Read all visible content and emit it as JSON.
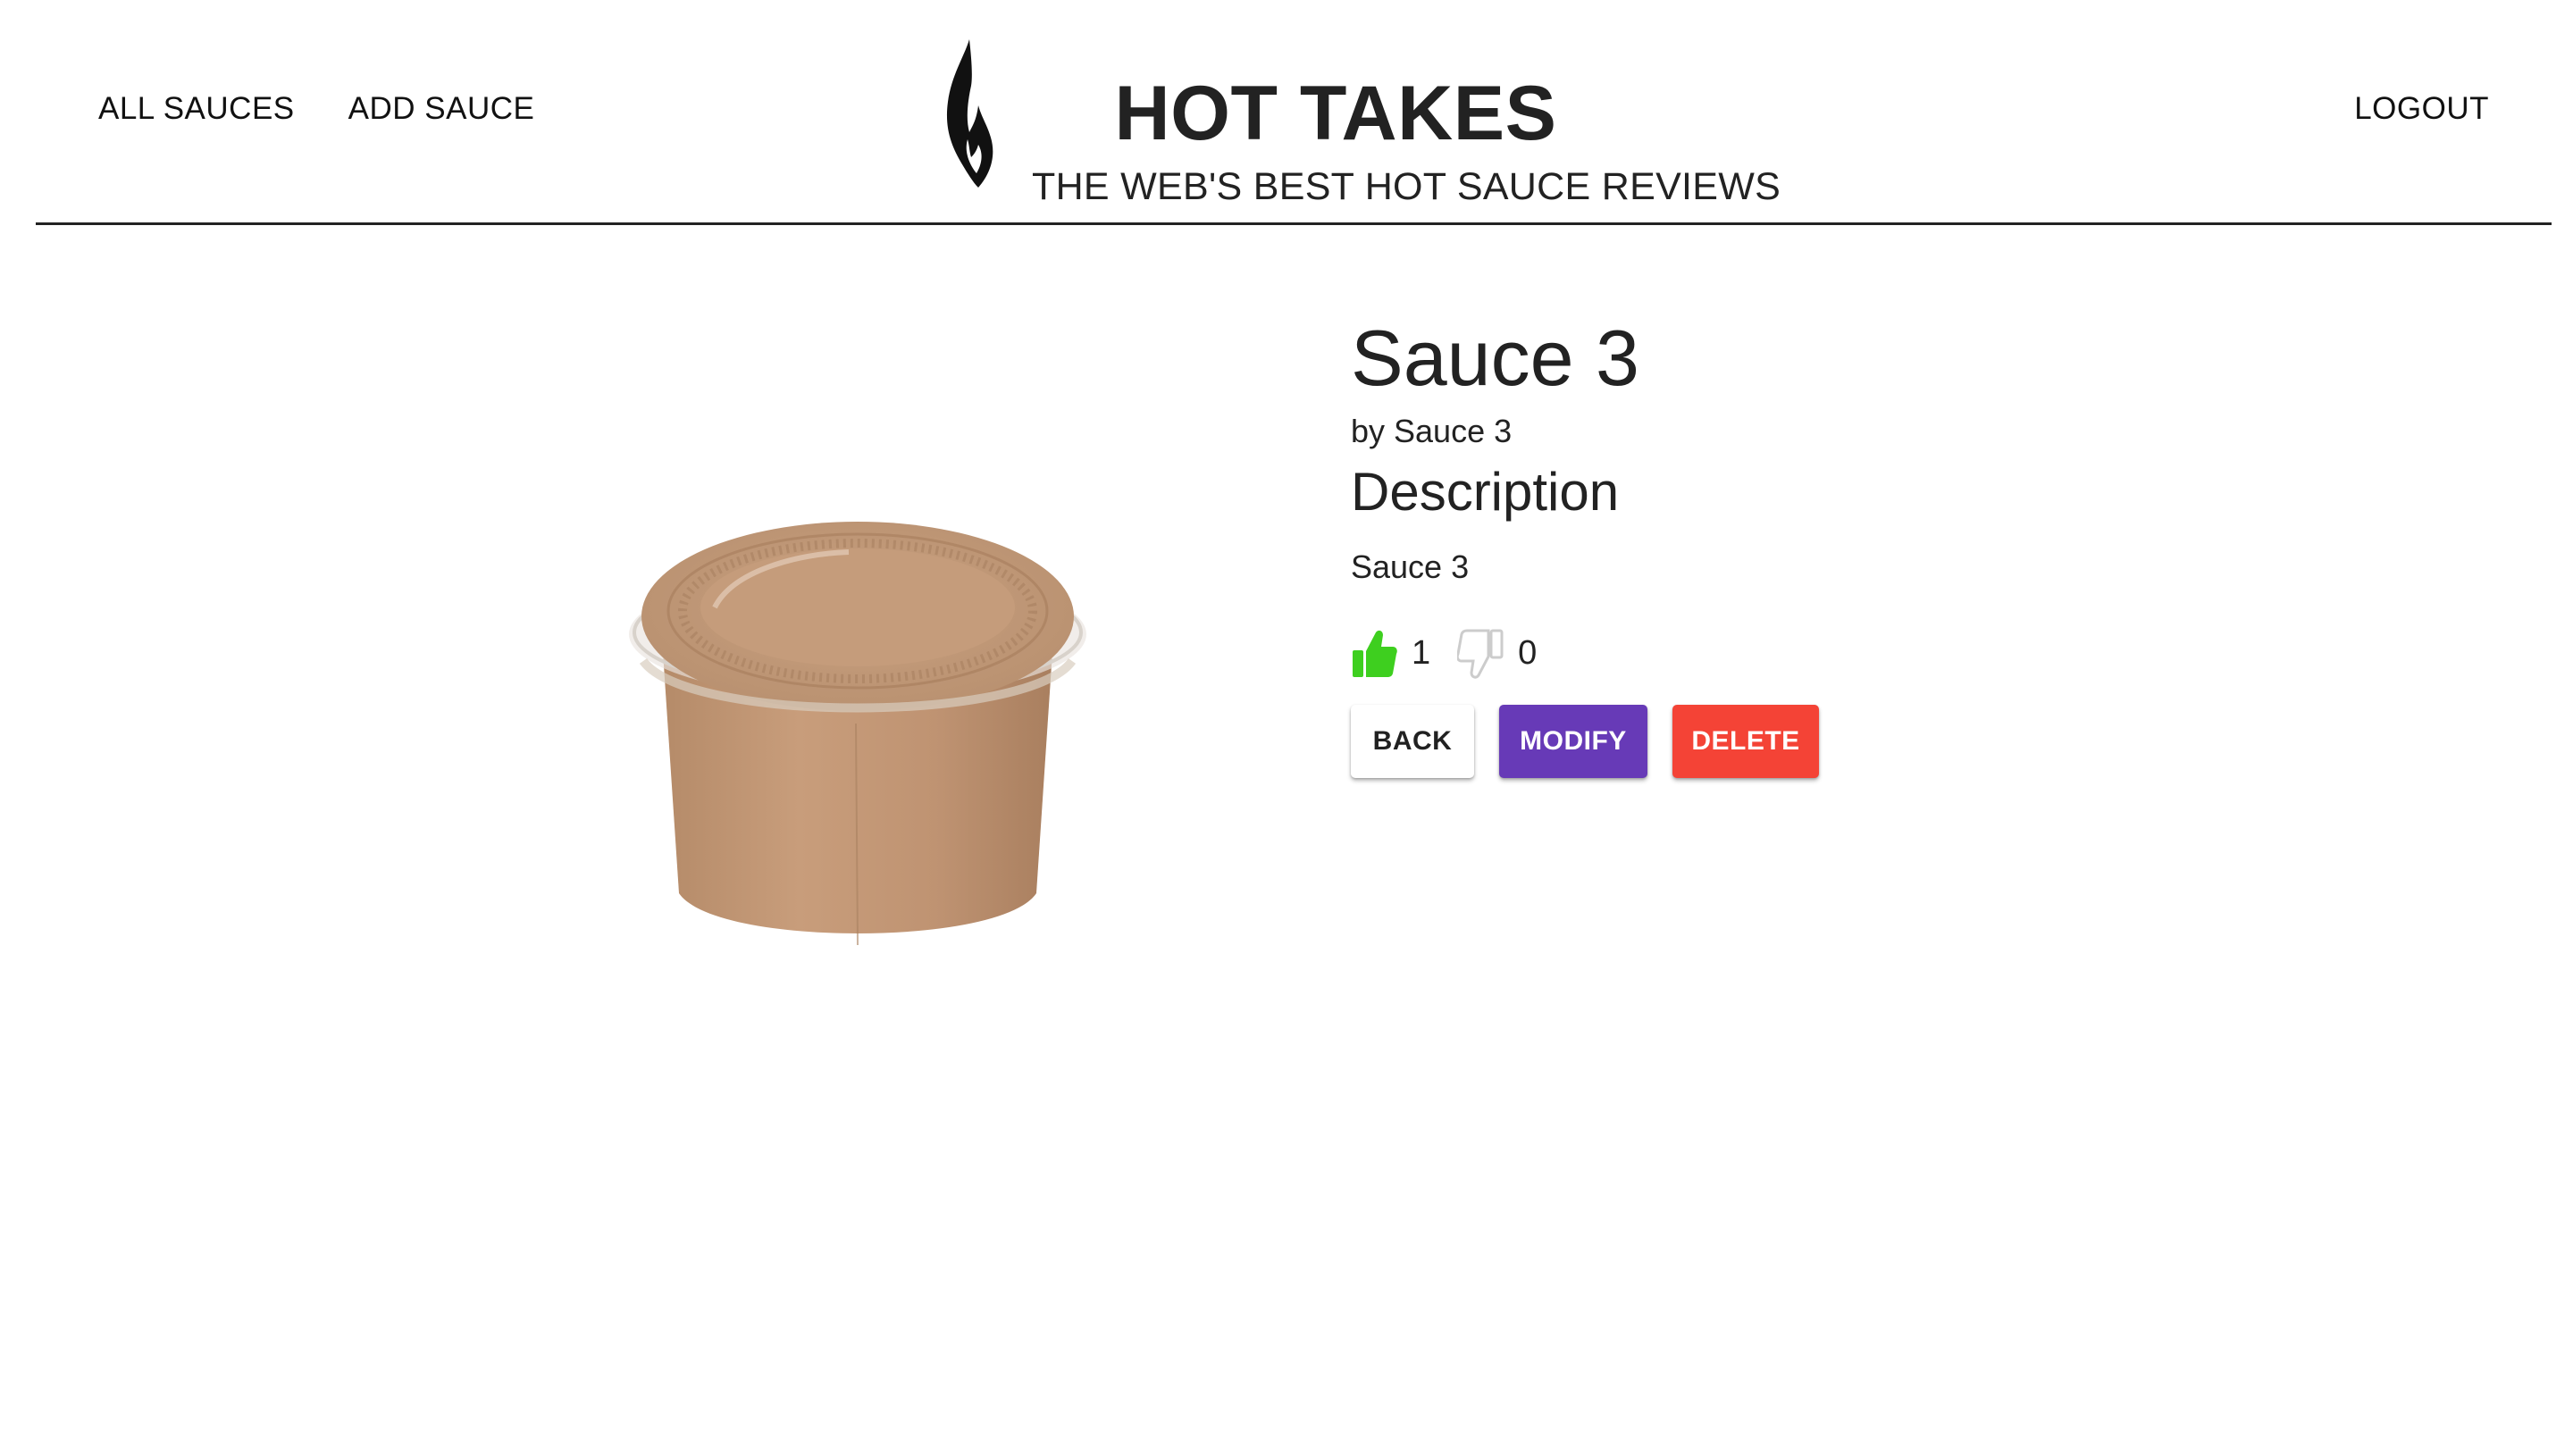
{
  "nav": {
    "all_sauces": "ALL SAUCES",
    "add_sauce": "ADD SAUCE",
    "logout": "LOGOUT"
  },
  "brand": {
    "title": "HOT TAKES",
    "subtitle": "THE WEB'S BEST HOT SAUCE REVIEWS",
    "logo_icon": "flame-icon"
  },
  "sauce": {
    "name": "Sauce 3",
    "manufacturer": "by Sauce 3",
    "description_heading": "Description",
    "description": "Sauce 3",
    "likes": "1",
    "dislikes": "0",
    "image_icon": "sauce-cup-image"
  },
  "actions": {
    "back": "BACK",
    "modify": "MODIFY",
    "delete": "DELETE"
  },
  "colors": {
    "like_active": "#3ecf1f",
    "dislike_inactive": "#cccccc",
    "modify": "#673ab7",
    "delete": "#f44336"
  }
}
